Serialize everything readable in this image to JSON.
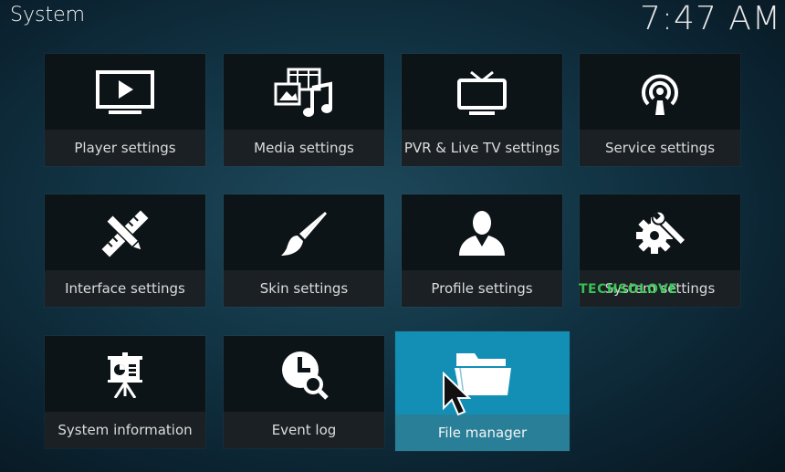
{
  "header": {
    "title": "System",
    "clock": "7:47 AM"
  },
  "tiles": [
    {
      "label": "Player settings",
      "icon": "monitor-play-icon"
    },
    {
      "label": "Media settings",
      "icon": "media-icon"
    },
    {
      "label": "PVR & Live TV settings",
      "icon": "tv-icon"
    },
    {
      "label": "Service settings",
      "icon": "broadcast-icon"
    },
    {
      "label": "Interface settings",
      "icon": "pencil-ruler-icon"
    },
    {
      "label": "Skin settings",
      "icon": "paintbrush-icon"
    },
    {
      "label": "Profile settings",
      "icon": "user-icon"
    },
    {
      "label": "System settings",
      "icon": "gear-wrench-icon"
    },
    {
      "label": "System information",
      "icon": "presentation-board-icon"
    },
    {
      "label": "Event log",
      "icon": "clock-search-icon"
    },
    {
      "label": "File manager",
      "icon": "folder-icon"
    }
  ],
  "watermark": "TECHSOLOVE",
  "colors": {
    "focus": "#138fb5",
    "tile": "#0d1418"
  }
}
